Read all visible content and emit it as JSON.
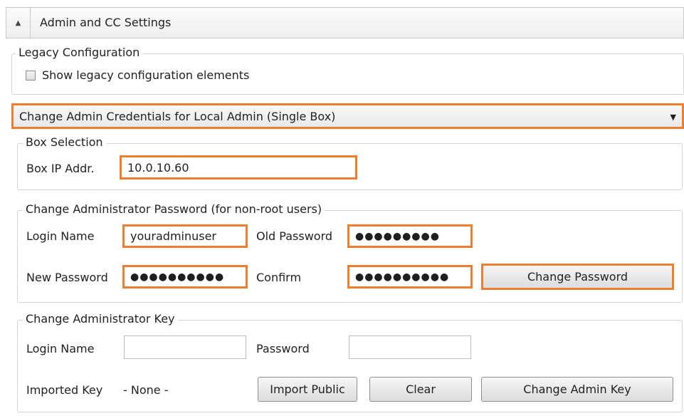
{
  "header": {
    "title": "Admin and CC Settings",
    "collapse_glyph": "▲"
  },
  "legacy": {
    "legend": "Legacy Configuration",
    "checkbox_label": "Show legacy configuration elements",
    "checked": false
  },
  "mode_dropdown": {
    "selected": "Change Admin Credentials for Local Admin (Single Box)",
    "arrow_glyph": "▼"
  },
  "box_selection": {
    "legend": "Box Selection",
    "ip_label": "Box IP Addr.",
    "ip_value": "10.0.10.60"
  },
  "change_password": {
    "legend": "Change Administrator Password (for non-root users)",
    "login_label": "Login Name",
    "login_value": "youradminuser",
    "old_label": "Old Password",
    "old_value": "●●●●●●●●●",
    "new_label": "New Password",
    "new_value": "●●●●●●●●●●",
    "confirm_label": "Confirm",
    "confirm_value": "●●●●●●●●●●",
    "button": "Change Password"
  },
  "change_key": {
    "legend": "Change Administrator Key",
    "login_label": "Login Name",
    "login_value": "",
    "password_label": "Password",
    "password_value": "",
    "imported_label": "Imported Key",
    "imported_value": "- None -",
    "import_button": "Import Public",
    "clear_button": "Clear",
    "change_button": "Change Admin Key"
  },
  "colors": {
    "highlight": "#ed7d31",
    "border": "#d5d5d5"
  }
}
